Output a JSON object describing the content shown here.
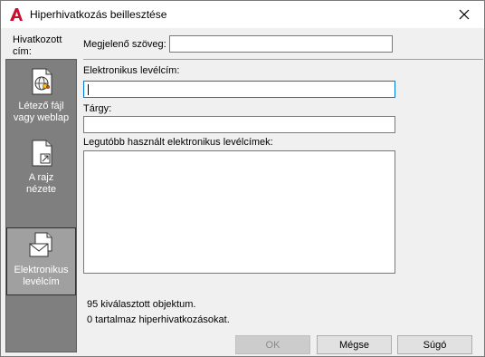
{
  "window": {
    "title": "Hiperhivatkozás beillesztése",
    "icon": "autocad-icon",
    "close_icon": "close-icon"
  },
  "sidebar": {
    "label": "Hivatkozott cím:",
    "items": [
      {
        "label_line1": "Létező fájl",
        "label_line2": "vagy weblap",
        "icon": "web-file-icon",
        "selected": false
      },
      {
        "label_line1": "A rajz",
        "label_line2": "nézete",
        "icon": "drawing-view-icon",
        "selected": false
      },
      {
        "label_line1": "Elektronikus",
        "label_line2": "levélcím",
        "icon": "email-icon",
        "selected": true
      }
    ]
  },
  "form": {
    "display_text_label": "Megjelenő szöveg:",
    "display_text_value": "",
    "email_label": "Elektronikus levélcím:",
    "email_value": "",
    "subject_label": "Tárgy:",
    "subject_value": "",
    "recent_label": "Legutóbb használt elektronikus levélcímek:",
    "recent_items": []
  },
  "status": {
    "line1": "95 kiválasztott objektum.",
    "line2": "0 tartalmaz hiperhivatkozásokat."
  },
  "buttons": {
    "ok": "OK",
    "cancel": "Mégse",
    "help": "Súgó"
  },
  "colors": {
    "accent": "#0078d7",
    "sidebar_bg": "#7f7f7f",
    "selected_bg": "#a0a0a0",
    "app_icon_red": "#c8102e"
  }
}
